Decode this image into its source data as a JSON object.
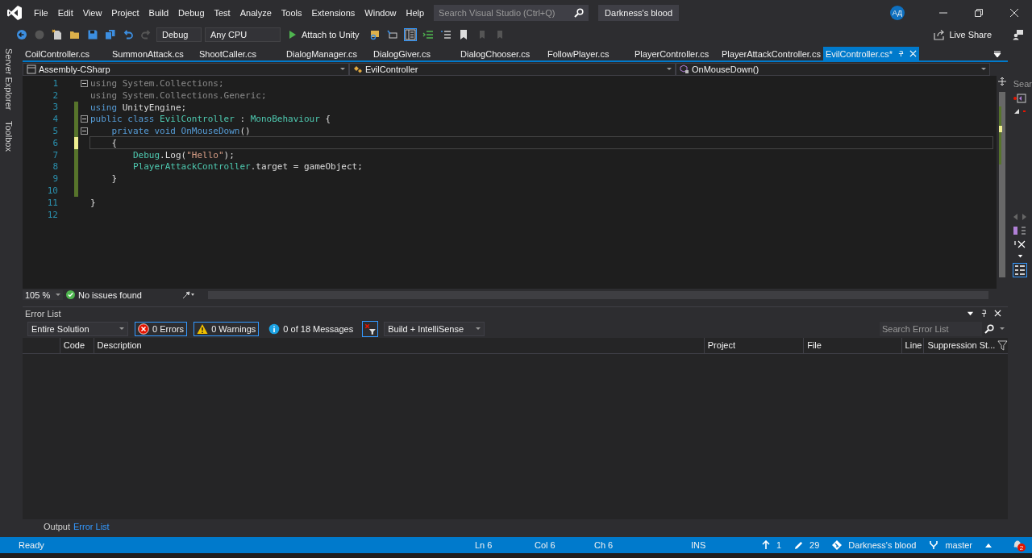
{
  "menu": [
    "File",
    "Edit",
    "View",
    "Project",
    "Build",
    "Debug",
    "Test",
    "Analyze",
    "Tools",
    "Extensions",
    "Window",
    "Help"
  ],
  "search": {
    "placeholder": "Search Visual Studio (Ctrl+Q)"
  },
  "window": {
    "title": "Darkness's blood"
  },
  "account": {
    "initials": "АД"
  },
  "toolbar": {
    "configuration": "Debug",
    "platform": "Any CPU",
    "run": "Attach to Unity",
    "live_share": "Live Share"
  },
  "side_tabs": [
    "Server Explorer",
    "Toolbox"
  ],
  "tabs": [
    {
      "label": "CoilController.cs",
      "selected": false
    },
    {
      "label": "SummonAttack.cs",
      "selected": false
    },
    {
      "label": "ShootCaller.cs",
      "selected": false
    },
    {
      "label": "DialogManager.cs",
      "selected": false
    },
    {
      "label": "DialogGiver.cs",
      "selected": false
    },
    {
      "label": "DialogChooser.cs",
      "selected": false
    },
    {
      "label": "FollowPlayer.cs",
      "selected": false
    },
    {
      "label": "PlayerController.cs",
      "selected": false
    },
    {
      "label": "PlayerAttackController.cs",
      "selected": false
    },
    {
      "label": "EvilController.cs*",
      "selected": true
    }
  ],
  "navigation": {
    "project": "Assembly-CSharp",
    "type": "EvilController",
    "member": "OnMouseDown()"
  },
  "code": [
    {
      "number": "1",
      "fold": true,
      "modified": false,
      "unsaved": false,
      "current": false,
      "tokens": [
        {
          "kind": "faded",
          "text": "using System.Collections;"
        }
      ]
    },
    {
      "number": "2",
      "fold": false,
      "modified": false,
      "unsaved": false,
      "current": false,
      "tokens": [
        {
          "kind": "faded",
          "text": "using System.Collections.Generic;"
        }
      ]
    },
    {
      "number": "3",
      "fold": false,
      "modified": true,
      "unsaved": false,
      "current": false,
      "tokens": [
        {
          "kind": "keyword",
          "text": "using "
        },
        {
          "kind": "text",
          "text": "UnityEngine;"
        }
      ]
    },
    {
      "number": "4",
      "fold": true,
      "modified": true,
      "unsaved": false,
      "current": false,
      "tokens": [
        {
          "kind": "keyword",
          "text": "public class "
        },
        {
          "kind": "type",
          "text": "EvilController"
        },
        {
          "kind": "text",
          "text": " : "
        },
        {
          "kind": "type",
          "text": "MonoBehaviour"
        },
        {
          "kind": "text",
          "text": " {"
        }
      ]
    },
    {
      "number": "5",
      "fold": true,
      "modified": true,
      "unsaved": false,
      "current": false,
      "tokens": [
        {
          "kind": "keyword",
          "text": "    private void "
        },
        {
          "kind": "method",
          "text": "OnMouseDown"
        },
        {
          "kind": "text",
          "text": "()"
        }
      ]
    },
    {
      "number": "6",
      "fold": false,
      "modified": true,
      "unsaved": true,
      "current": true,
      "tokens": [
        {
          "kind": "text",
          "text": "    {"
        }
      ]
    },
    {
      "number": "7",
      "fold": false,
      "modified": true,
      "unsaved": false,
      "current": false,
      "tokens": [
        {
          "kind": "type",
          "text": "        Debug"
        },
        {
          "kind": "text",
          "text": ".Log("
        },
        {
          "kind": "string",
          "text": "\"Hello\""
        },
        {
          "kind": "text",
          "text": ");"
        }
      ]
    },
    {
      "number": "8",
      "fold": false,
      "modified": true,
      "unsaved": false,
      "current": false,
      "tokens": [
        {
          "kind": "type",
          "text": "        PlayerAttackController"
        },
        {
          "kind": "text",
          "text": ".target = gameObject;"
        }
      ]
    },
    {
      "number": "9",
      "fold": false,
      "modified": true,
      "unsaved": false,
      "current": false,
      "tokens": [
        {
          "kind": "text",
          "text": "    }"
        }
      ]
    },
    {
      "number": "10",
      "fold": false,
      "modified": true,
      "unsaved": false,
      "current": false
    },
    {
      "number": "11",
      "fold": false,
      "modified": false,
      "unsaved": false,
      "current": false,
      "tokens": [
        {
          "kind": "text",
          "text": "}"
        }
      ]
    },
    {
      "number": "12",
      "fold": false,
      "modified": false,
      "unsaved": false,
      "current": false
    }
  ],
  "right_panel": {
    "search_fragment": "Sear"
  },
  "editor_status": {
    "zoom": "105 %",
    "issues": "No issues found"
  },
  "error_list": {
    "title": "Error List",
    "scope": "Entire Solution",
    "filters": [
      {
        "kind": "error",
        "label": "0 Errors",
        "selected": true
      },
      {
        "kind": "warning",
        "label": "0 Warnings",
        "selected": true
      },
      {
        "kind": "info",
        "label": "0 of 18 Messages",
        "selected": false
      }
    ],
    "source": "Build + IntelliSense",
    "search": {
      "placeholder": "Search Error List"
    },
    "columns": [
      "Code",
      "Description",
      "Project",
      "File",
      "Line",
      "Suppression St..."
    ]
  },
  "bottom_tabs": [
    {
      "label": "Output",
      "selected": false
    },
    {
      "label": "Error List",
      "selected": true
    }
  ],
  "status_bar": {
    "state": "Ready",
    "line": "Ln 6",
    "column": "Col 6",
    "char": "Ch 6",
    "mode": "INS",
    "pushes": "1",
    "changes": "29",
    "repository": "Darkness's blood",
    "branch": "master",
    "notifications": "2"
  }
}
